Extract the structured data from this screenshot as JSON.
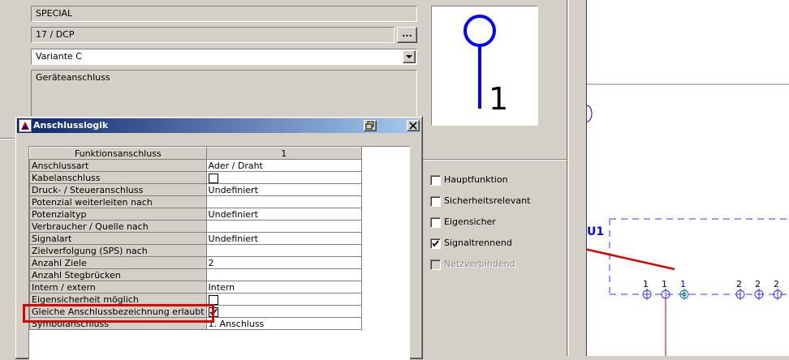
{
  "form": {
    "field1": "SPECIAL",
    "field2": "17 / DCP",
    "browse_label": "...",
    "variant_select": "Variante C",
    "description": "Geräteanschluss"
  },
  "preview": {
    "symbol_number": "1"
  },
  "dialog": {
    "title": "Anschlusslogik",
    "header_col1": "Funktionsanschluss",
    "header_col2": "1",
    "rows": [
      {
        "label": "Anschlussart",
        "value": "Ader / Draht"
      },
      {
        "label": "Kabelanschluss",
        "value": ""
      },
      {
        "label": "Druck- / Steueranschluss",
        "value": "Undefiniert"
      },
      {
        "label": "Potenzial weiterleiten nach",
        "value": ""
      },
      {
        "label": "Potenzialtyp",
        "value": "Undefiniert"
      },
      {
        "label": "Verbraucher / Quelle nach",
        "value": ""
      },
      {
        "label": "Signalart",
        "value": "Undefiniert"
      },
      {
        "label": "Zielverfolgung (SPS) nach",
        "value": ""
      },
      {
        "label": "Anzahl Ziele",
        "value": "2"
      },
      {
        "label": "Anzahl Stegbrücken",
        "value": ""
      },
      {
        "label": "Intern / extern",
        "value": "Intern"
      },
      {
        "label": "Eigensicherheit möglich",
        "value": ""
      },
      {
        "label": "Gleiche Anschlussbezeichnung erlaubt",
        "value": ""
      },
      {
        "label": "Symbolanschluss",
        "value": "1. Anschluss"
      }
    ]
  },
  "checkboxes": [
    {
      "label": "Hauptfunktion",
      "checked": false,
      "enabled": true
    },
    {
      "label": "Sicherheitsrelevant",
      "checked": false,
      "enabled": true
    },
    {
      "label": "Eigensicher",
      "checked": false,
      "enabled": true
    },
    {
      "label": "Signaltrennend",
      "checked": true,
      "enabled": true
    },
    {
      "label": "Netzverbindend",
      "checked": false,
      "enabled": false
    }
  ],
  "canvas": {
    "device_label": "U1",
    "pin_labels": [
      "1",
      "1",
      "1",
      "2",
      "2",
      "2"
    ],
    "highlight_color": "#e00000",
    "symbol_color": "#0000ff"
  }
}
